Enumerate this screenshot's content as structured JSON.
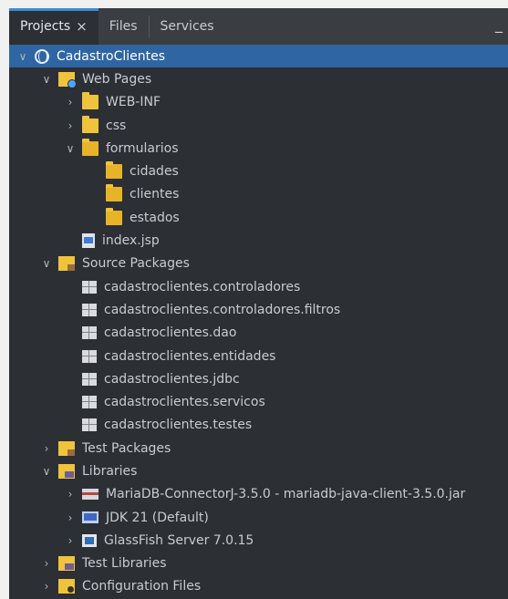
{
  "tabs": {
    "projects": "Projects",
    "files": "Files",
    "services": "Services",
    "close_symbol": "×",
    "minimize_symbol": "_"
  },
  "tree": [
    {
      "label": "CadastroClientes",
      "indent": 0,
      "twisty": "open",
      "icon": "globe-icon",
      "selected": true
    },
    {
      "label": "Web Pages",
      "indent": 1,
      "twisty": "open",
      "icon": "web-pages-folder-icon"
    },
    {
      "label": "WEB-INF",
      "indent": 2,
      "twisty": "closed",
      "icon": "folder-icon"
    },
    {
      "label": "css",
      "indent": 2,
      "twisty": "closed",
      "icon": "folder-icon"
    },
    {
      "label": "formularios",
      "indent": 2,
      "twisty": "open",
      "icon": "folder-open-icon"
    },
    {
      "label": "cidades",
      "indent": 3,
      "twisty": "none",
      "icon": "folder-open-icon"
    },
    {
      "label": "clientes",
      "indent": 3,
      "twisty": "none",
      "icon": "folder-open-icon"
    },
    {
      "label": "estados",
      "indent": 3,
      "twisty": "none",
      "icon": "folder-open-icon"
    },
    {
      "label": "index.jsp",
      "indent": 2,
      "twisty": "none",
      "icon": "jsp-file-icon"
    },
    {
      "label": "Source Packages",
      "indent": 1,
      "twisty": "open",
      "icon": "source-packages-icon"
    },
    {
      "label": "cadastroclientes.controladores",
      "indent": 2,
      "twisty": "none",
      "icon": "package-icon"
    },
    {
      "label": "cadastroclientes.controladores.filtros",
      "indent": 2,
      "twisty": "none",
      "icon": "package-icon"
    },
    {
      "label": "cadastroclientes.dao",
      "indent": 2,
      "twisty": "none",
      "icon": "package-icon"
    },
    {
      "label": "cadastroclientes.entidades",
      "indent": 2,
      "twisty": "none",
      "icon": "package-icon"
    },
    {
      "label": "cadastroclientes.jdbc",
      "indent": 2,
      "twisty": "none",
      "icon": "package-icon"
    },
    {
      "label": "cadastroclientes.servicos",
      "indent": 2,
      "twisty": "none",
      "icon": "package-icon"
    },
    {
      "label": "cadastroclientes.testes",
      "indent": 2,
      "twisty": "none",
      "icon": "package-icon"
    },
    {
      "label": "Test Packages",
      "indent": 1,
      "twisty": "closed",
      "icon": "test-packages-icon"
    },
    {
      "label": "Libraries",
      "indent": 1,
      "twisty": "open",
      "icon": "libraries-icon"
    },
    {
      "label": "MariaDB-ConnectorJ-3.5.0 - mariadb-java-client-3.5.0.jar",
      "indent": 2,
      "twisty": "closed",
      "icon": "jar-icon"
    },
    {
      "label": "JDK 21 (Default)",
      "indent": 2,
      "twisty": "closed",
      "icon": "jdk-icon"
    },
    {
      "label": "GlassFish Server 7.0.15",
      "indent": 2,
      "twisty": "closed",
      "icon": "server-icon"
    },
    {
      "label": "Test Libraries",
      "indent": 1,
      "twisty": "closed",
      "icon": "test-libraries-icon"
    },
    {
      "label": "Configuration Files",
      "indent": 1,
      "twisty": "closed",
      "icon": "configuration-files-icon"
    }
  ]
}
